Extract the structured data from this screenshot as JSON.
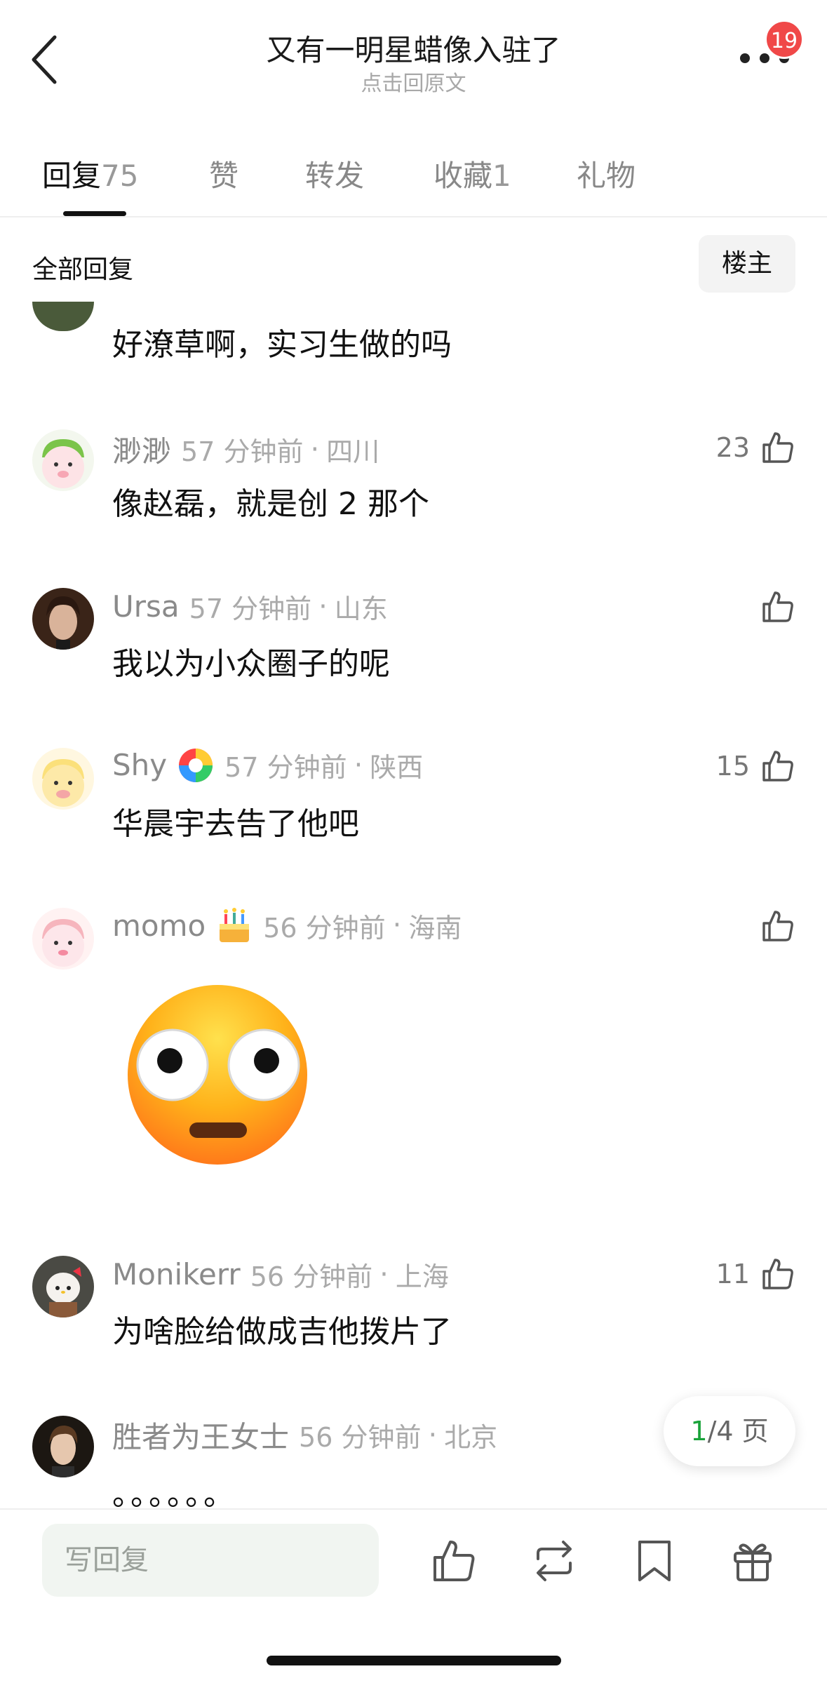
{
  "header": {
    "title": "又有一明星蜡像入驻了",
    "subtitle": "点击回原文",
    "badge_count": "19"
  },
  "tabs": [
    {
      "label": "回复",
      "count": "75",
      "active": true
    },
    {
      "label": "赞",
      "count": ""
    },
    {
      "label": "转发",
      "count": ""
    },
    {
      "label": "收藏",
      "count": "1"
    },
    {
      "label": "礼物",
      "count": ""
    }
  ],
  "filter": {
    "label": "全部回复",
    "owner_button": "楼主"
  },
  "comments": [
    {
      "text": "好潦草啊，实习生做的吗"
    },
    {
      "name": "渺渺",
      "time": "57 分钟前",
      "sep": "·",
      "location": "四川",
      "text": "像赵磊，就是创 2 那个",
      "likes": "23"
    },
    {
      "name": "Ursa",
      "time": "57 分钟前",
      "sep": "·",
      "location": "山东",
      "text": "我以为小众圈子的呢",
      "likes": ""
    },
    {
      "name": "Shy",
      "time": "57 分钟前",
      "sep": "·",
      "location": "陕西",
      "text": "华晨宇去告了他吧",
      "likes": "15"
    },
    {
      "name": "momo",
      "time": "56 分钟前",
      "sep": "·",
      "location": "海南",
      "text": "",
      "likes": ""
    },
    {
      "name": "Monikerr",
      "time": "56 分钟前",
      "sep": "·",
      "location": "上海",
      "text": "为啥脸给做成吉他拨片了",
      "likes": "11"
    },
    {
      "name": "胜者为王女士",
      "time": "56 分钟前",
      "sep": "·",
      "location": "北京",
      "text": "。。。。。。"
    }
  ],
  "pager": {
    "current": "1",
    "rest": "/4 页"
  },
  "bottom": {
    "reply_placeholder": "写回复"
  }
}
